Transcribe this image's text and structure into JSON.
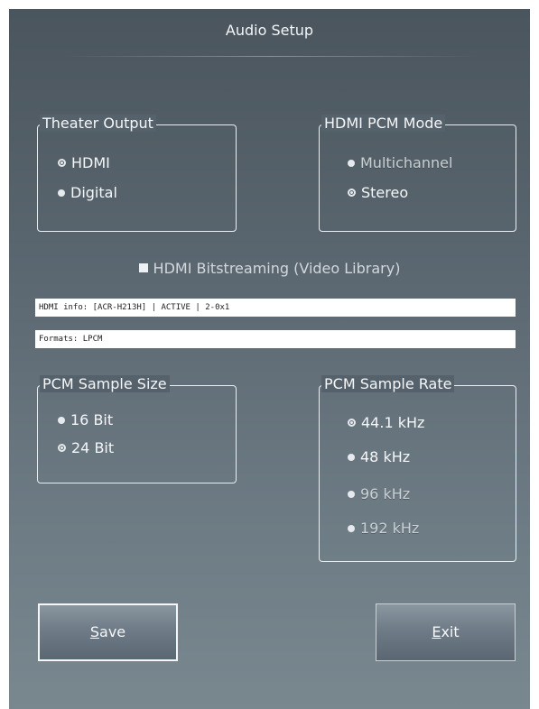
{
  "dialog": {
    "title": "Audio Setup"
  },
  "theater_output": {
    "legend": "Theater Output",
    "options": [
      {
        "label": "HDMI",
        "selected": true,
        "disabled": false
      },
      {
        "label": "Digital",
        "selected": false,
        "disabled": false
      }
    ]
  },
  "hdmi_pcm_mode": {
    "legend": "HDMI PCM Mode",
    "options": [
      {
        "label": "Multichannel",
        "selected": false,
        "disabled": true
      },
      {
        "label": "Stereo",
        "selected": true,
        "disabled": false
      }
    ]
  },
  "bitstreaming": {
    "label": "HDMI Bitstreaming (Video Library)",
    "checked": false
  },
  "info": {
    "hdmi_info": "HDMI info: [ACR-H213H] | ACTIVE | 2-0x1",
    "formats": "Formats: LPCM"
  },
  "pcm_sample_size": {
    "legend": "PCM Sample Size",
    "options": [
      {
        "label": "16 Bit",
        "selected": false,
        "disabled": false
      },
      {
        "label": "24 Bit",
        "selected": true,
        "disabled": false
      }
    ]
  },
  "pcm_sample_rate": {
    "legend": "PCM Sample Rate",
    "options": [
      {
        "label": "44.1 kHz",
        "selected": true,
        "disabled": false
      },
      {
        "label": "48 kHz",
        "selected": false,
        "disabled": false
      },
      {
        "label": "96 kHz",
        "selected": false,
        "disabled": true
      },
      {
        "label": "192 kHz",
        "selected": false,
        "disabled": true
      }
    ]
  },
  "buttons": {
    "save_mnemonic": "S",
    "save_rest": "ave",
    "exit_mnemonic": "E",
    "exit_rest": "xit"
  }
}
